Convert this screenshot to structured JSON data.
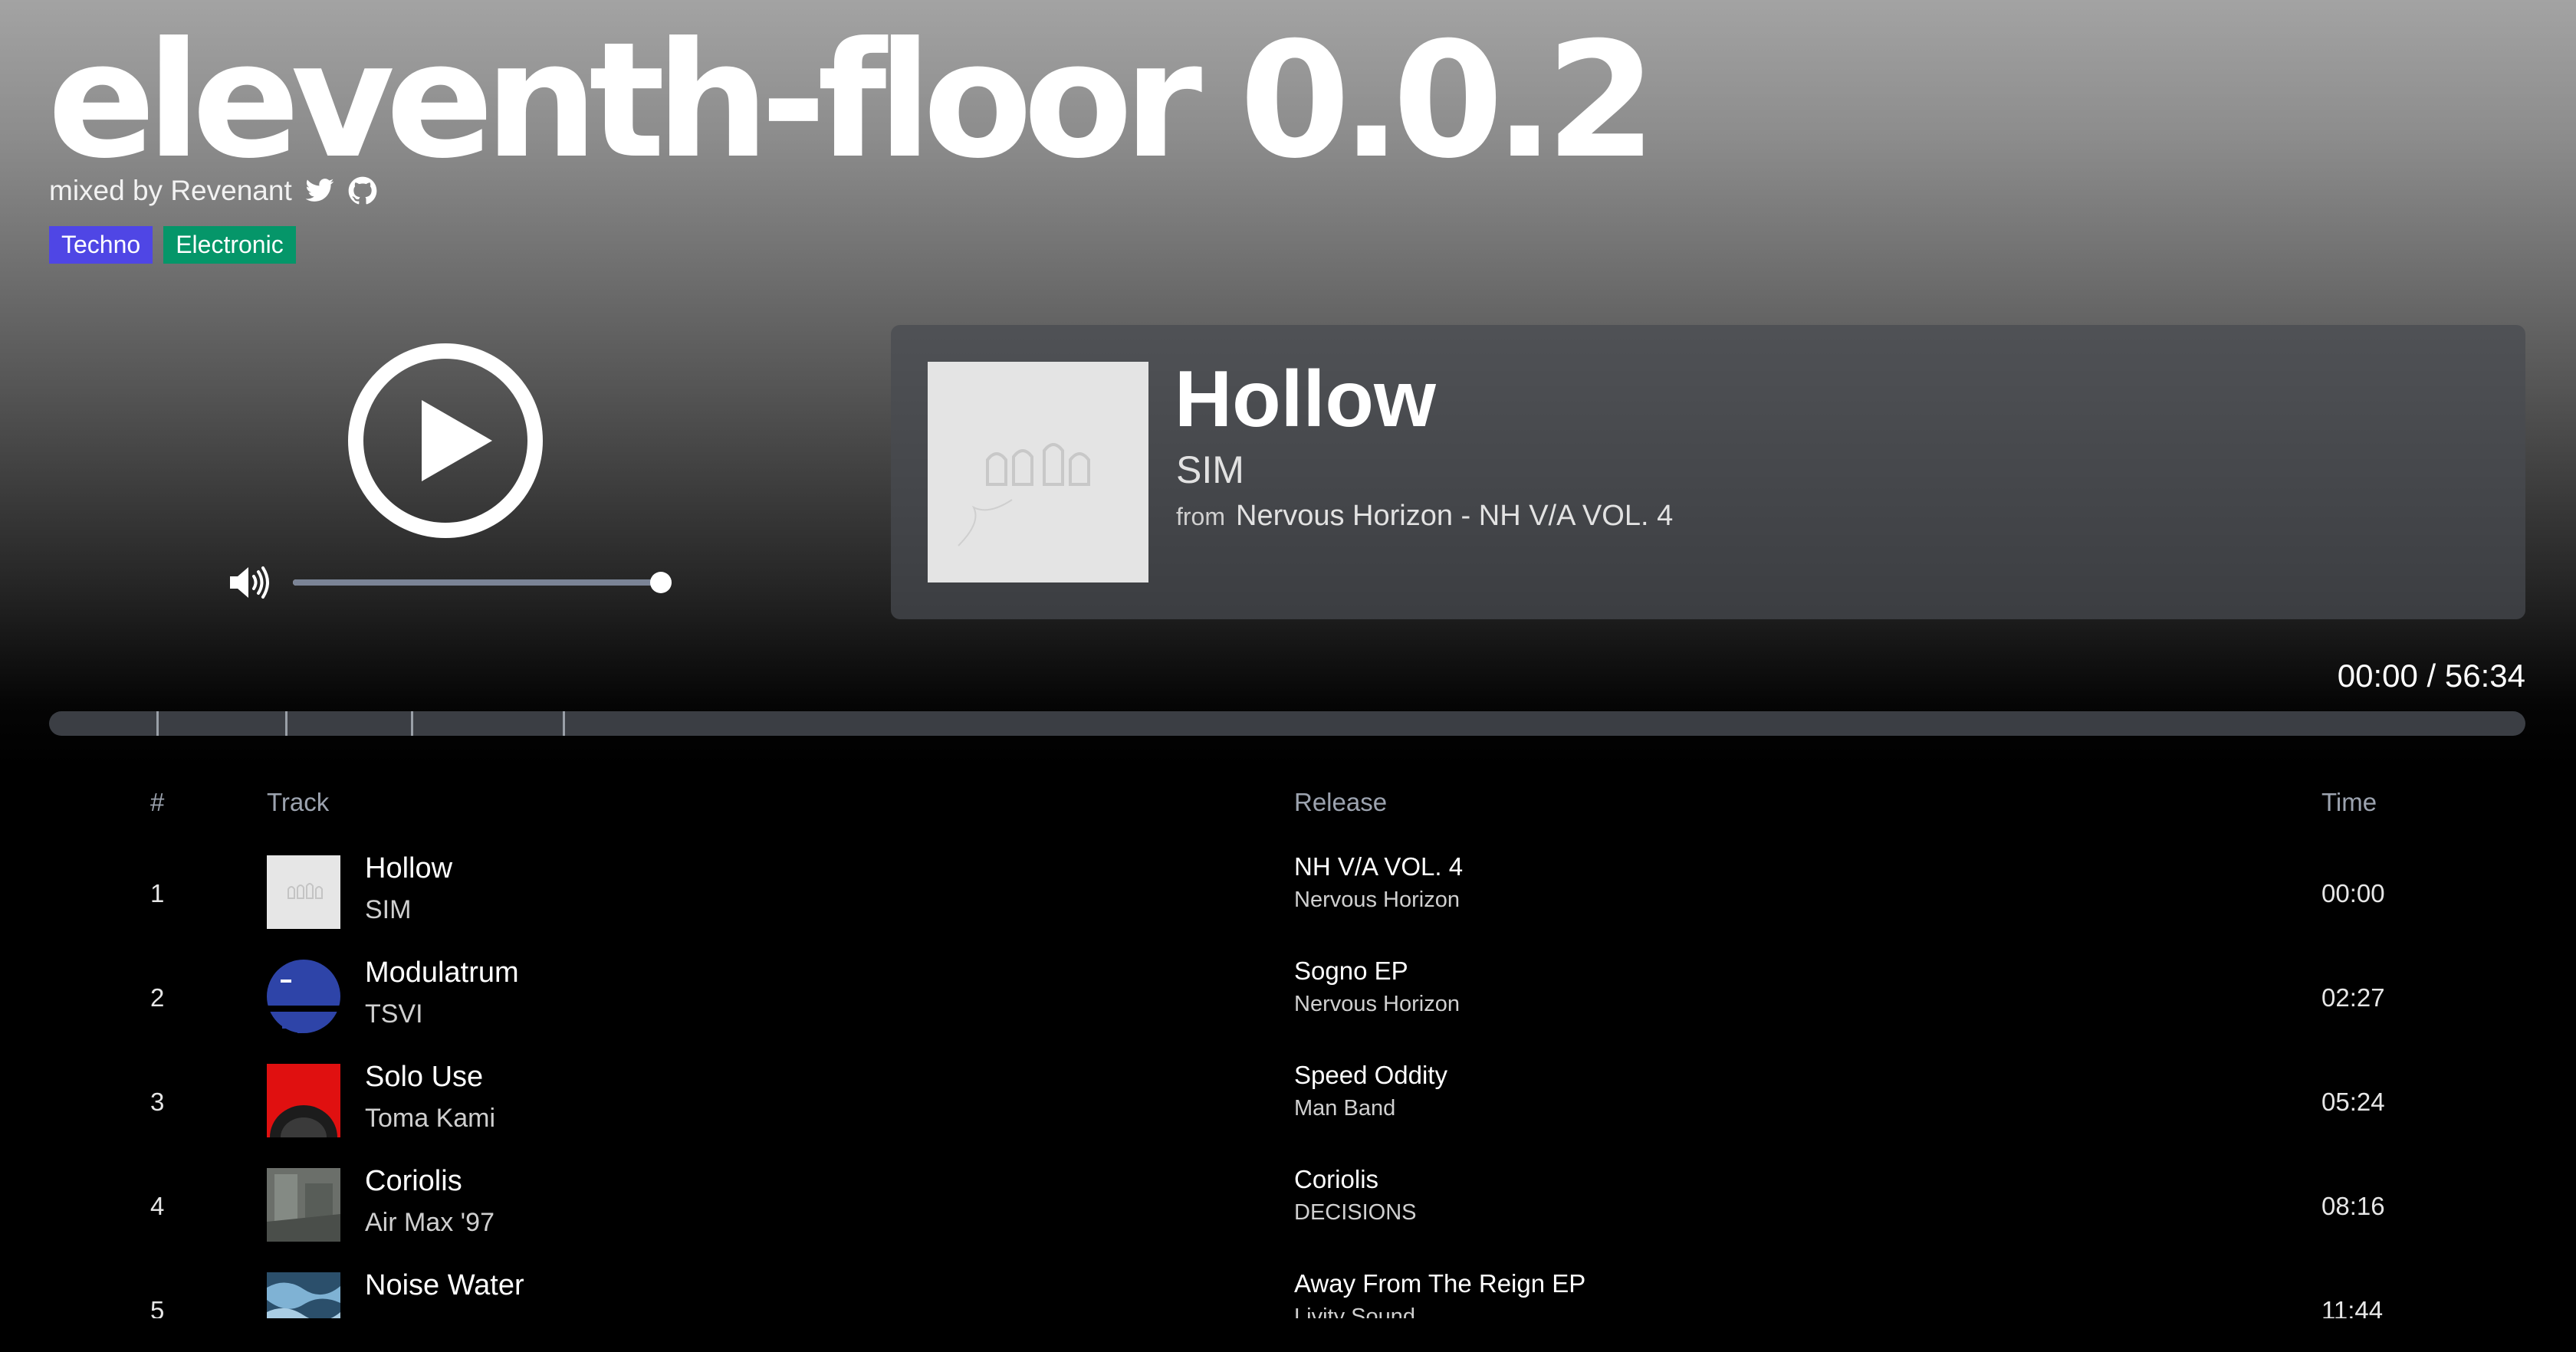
{
  "mix": {
    "title": "eleventh-floor 0.0.2",
    "byline": "mixed by Revenant",
    "social_icons": [
      "twitter-icon",
      "github-icon"
    ],
    "tags": [
      {
        "label": "Techno",
        "color": "#4f46e5"
      },
      {
        "label": "Electronic",
        "color": "#059669"
      }
    ]
  },
  "player": {
    "play_icon": "play-icon",
    "volume_icon": "speaker-icon",
    "volume_level": 1.0,
    "volume_track_color": "#7b8496",
    "time_display": "00:00 / 56:34"
  },
  "now_playing": {
    "title": "Hollow",
    "artist": "SIM",
    "from_label": "from",
    "release": "Nervous Horizon - NH V/A VOL. 4"
  },
  "tracklist": {
    "headers": {
      "number": "#",
      "track": "Track",
      "release": "Release",
      "time": "Time"
    },
    "tracks": [
      {
        "num": "1",
        "title": "Hollow",
        "artist": "SIM",
        "release": "NH V/A VOL. 4",
        "label": "Nervous Horizon",
        "time": "00:00"
      },
      {
        "num": "2",
        "title": "Modulatrum",
        "artist": "TSVI",
        "release": "Sogno EP",
        "label": "Nervous Horizon",
        "time": "02:27"
      },
      {
        "num": "3",
        "title": "Solo Use",
        "artist": "Toma Kami",
        "release": "Speed Oddity",
        "label": "Man Band",
        "time": "05:24"
      },
      {
        "num": "4",
        "title": "Coriolis",
        "artist": "Air Max '97",
        "release": "Coriolis",
        "label": "DECISIONS",
        "time": "08:16"
      },
      {
        "num": "5",
        "title": "Noise Water",
        "artist": "",
        "release": "Away From The Reign EP",
        "label": "Livity Sound",
        "time": "11:44"
      }
    ]
  }
}
